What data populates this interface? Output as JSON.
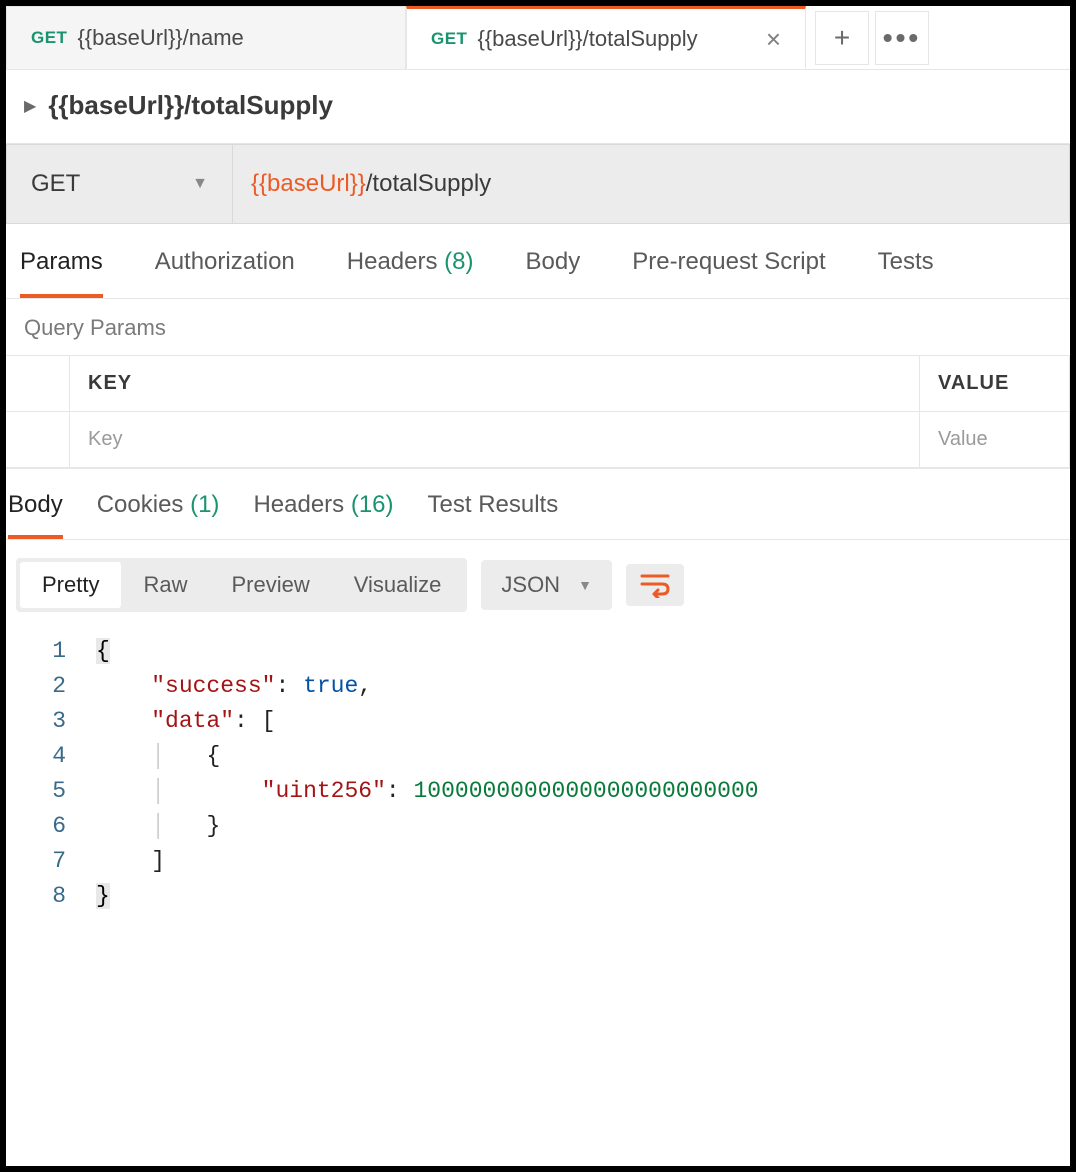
{
  "tabs": [
    {
      "method": "GET",
      "label": "{{baseUrl}}/name",
      "active": false
    },
    {
      "method": "GET",
      "label": "{{baseUrl}}/totalSupply",
      "active": true
    }
  ],
  "title": "{{baseUrl}}/totalSupply",
  "request": {
    "method": "GET",
    "url_var": "{{baseUrl}}",
    "url_path": "/totalSupply"
  },
  "req_tabs": {
    "params": "Params",
    "authorization": "Authorization",
    "headers": "Headers",
    "headers_count": "(8)",
    "body": "Body",
    "prerequest": "Pre-request Script",
    "tests": "Tests"
  },
  "query_params": {
    "section_label": "Query Params",
    "key_header": "KEY",
    "value_header": "VALUE",
    "key_placeholder": "Key",
    "value_placeholder": "Value"
  },
  "resp_tabs": {
    "body": "Body",
    "cookies": "Cookies",
    "cookies_count": "(1)",
    "headers": "Headers",
    "headers_count": "(16)",
    "test_results": "Test Results"
  },
  "view": {
    "pretty": "Pretty",
    "raw": "Raw",
    "preview": "Preview",
    "visualize": "Visualize",
    "lang": "JSON"
  },
  "response_json": {
    "lines": [
      "1",
      "2",
      "3",
      "4",
      "5",
      "6",
      "7",
      "8"
    ],
    "key_success": "\"success\"",
    "val_success": "true",
    "key_data": "\"data\"",
    "key_uint": "\"uint256\"",
    "val_uint": "1000000000000000000000000"
  }
}
